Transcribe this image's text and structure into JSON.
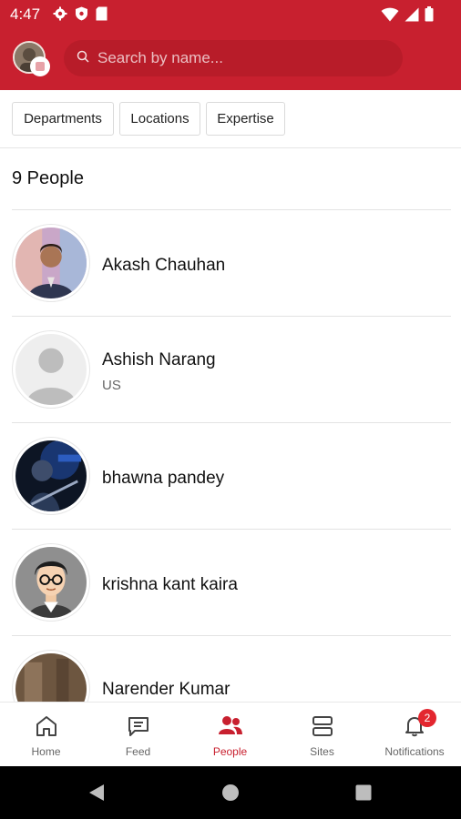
{
  "status_bar": {
    "time": "4:47",
    "left_icons": [
      "settings-icon",
      "shield-icon",
      "sim-card-icon"
    ],
    "right_icons": [
      "wifi-icon",
      "signal-icon",
      "battery-icon"
    ]
  },
  "header": {
    "accent_color": "#c8202f",
    "search_placeholder": "Search by name..."
  },
  "filters": [
    {
      "label": "Departments"
    },
    {
      "label": "Locations"
    },
    {
      "label": "Expertise"
    }
  ],
  "people_count": "9 People",
  "people": [
    {
      "name": "Akash Chauhan",
      "location": "",
      "avatar": "photo-man-suit"
    },
    {
      "name": "Ashish Narang",
      "location": "US",
      "avatar": "default-silhouette"
    },
    {
      "name": "bhawna pandey",
      "location": "",
      "avatar": "photo-guitar"
    },
    {
      "name": "krishna kant kaira",
      "location": "",
      "avatar": "cartoon-glasses"
    },
    {
      "name": "Narender Kumar",
      "location": "",
      "avatar": "photo-brown"
    }
  ],
  "bottom_nav": [
    {
      "label": "Home",
      "icon": "home-icon",
      "active": false
    },
    {
      "label": "Feed",
      "icon": "feed-icon",
      "active": false
    },
    {
      "label": "People",
      "icon": "people-icon",
      "active": true
    },
    {
      "label": "Sites",
      "icon": "sites-icon",
      "active": false
    },
    {
      "label": "Notifications",
      "icon": "bell-icon",
      "active": false
    }
  ],
  "notifications_badge": "2",
  "system_nav": [
    "back-icon",
    "home-circle-icon",
    "recents-icon"
  ]
}
